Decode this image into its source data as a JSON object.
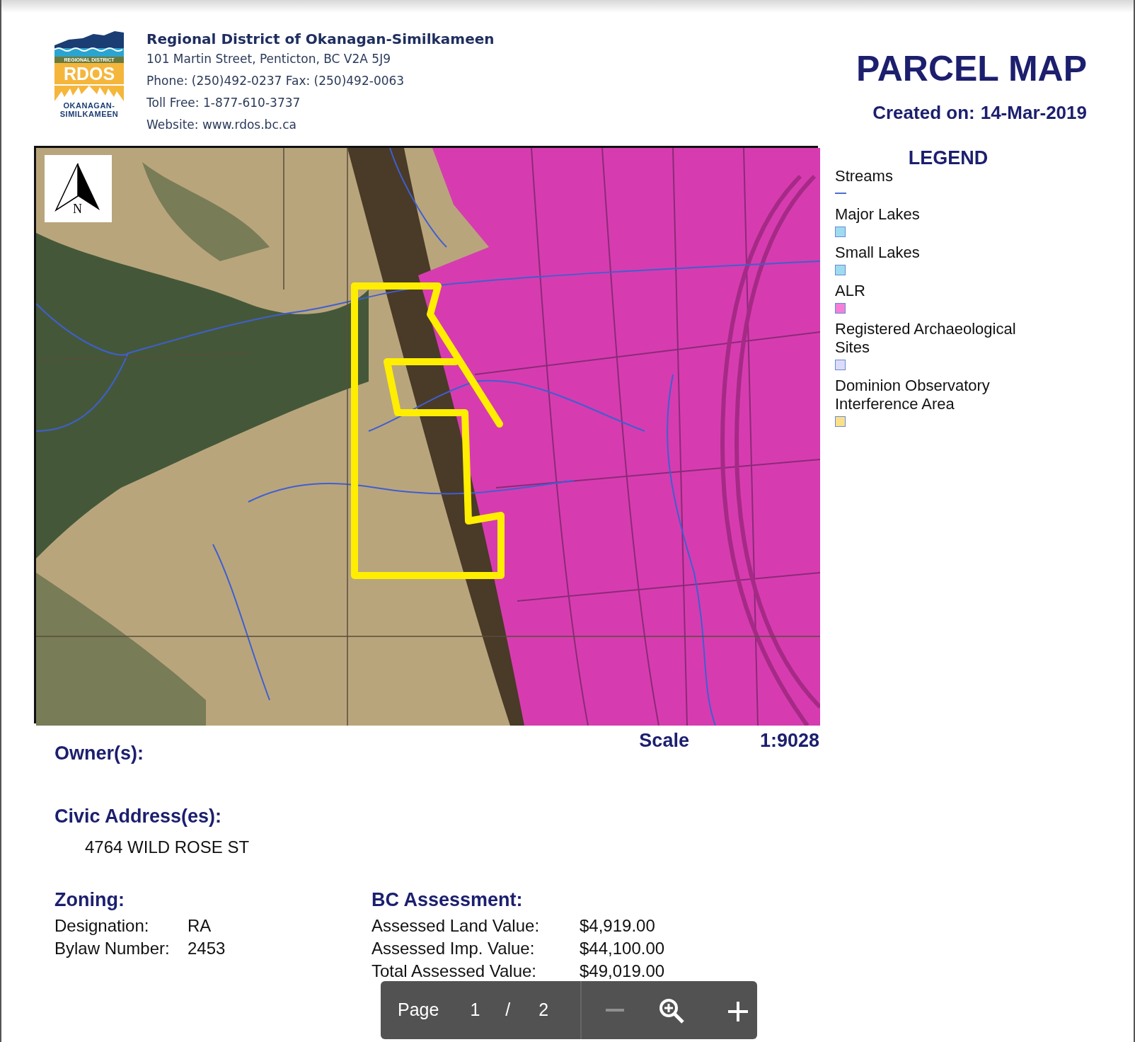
{
  "header": {
    "organization": "Regional District of Okanagan-Similkameen",
    "address": "101 Martin Street, Penticton, BC V2A 5J9",
    "phone": "Phone: (250)492-0237 Fax: (250)492-0063",
    "toll_free": "Toll Free: 1-877-610-3737",
    "website": "Website: www.rdos.bc.ca"
  },
  "logo": {
    "band": "REGIONAL DISTRICT",
    "initials": "RDOS",
    "name_lines": [
      "OKANAGAN-",
      "SIMILKAMEEN"
    ]
  },
  "title": "PARCEL MAP",
  "created": {
    "label": "Created on:",
    "date": "14-Mar-2019"
  },
  "map": {
    "north_label": "N"
  },
  "legend": {
    "title": "LEGEND",
    "items": [
      {
        "label": "Streams",
        "kind": "line",
        "color": "#4a6fd0"
      },
      {
        "label": "Major Lakes",
        "kind": "swatch",
        "color": "#9ddcf0"
      },
      {
        "label": "Small Lakes",
        "kind": "swatch",
        "color": "#9ddcf0"
      },
      {
        "label": "ALR",
        "kind": "swatch",
        "color": "#f47fd9"
      },
      {
        "label": "Registered Archaeological Sites",
        "kind": "swatch",
        "color": "#dcdcfa"
      },
      {
        "label": "Dominion Observatory Interference Area",
        "kind": "swatch",
        "color": "#fbe08a"
      }
    ]
  },
  "scale": {
    "label": "Scale",
    "value": "1:9028"
  },
  "owners": {
    "heading": "Owner(s):"
  },
  "civic": {
    "heading": "Civic Address(es):",
    "addresses": [
      "4764 WILD ROSE ST"
    ]
  },
  "zoning": {
    "heading": "Zoning:",
    "rows": [
      {
        "label": "Designation:",
        "value": "RA"
      },
      {
        "label": "Bylaw Number:",
        "value": "2453"
      }
    ]
  },
  "assessment": {
    "heading": "BC Assessment:",
    "rows": [
      {
        "label": "Assessed Land Value:",
        "value": "$4,919.00"
      },
      {
        "label": "Assessed Imp. Value:",
        "value": "$44,100.00"
      },
      {
        "label": "Total Assessed Value:",
        "value": "$49,019.00"
      }
    ]
  },
  "viewer_toolbar": {
    "page_label": "Page",
    "current_page": "1",
    "separator": "/",
    "page_count": "2",
    "zoom_out_disabled": true,
    "zoom_in_disabled": false
  }
}
